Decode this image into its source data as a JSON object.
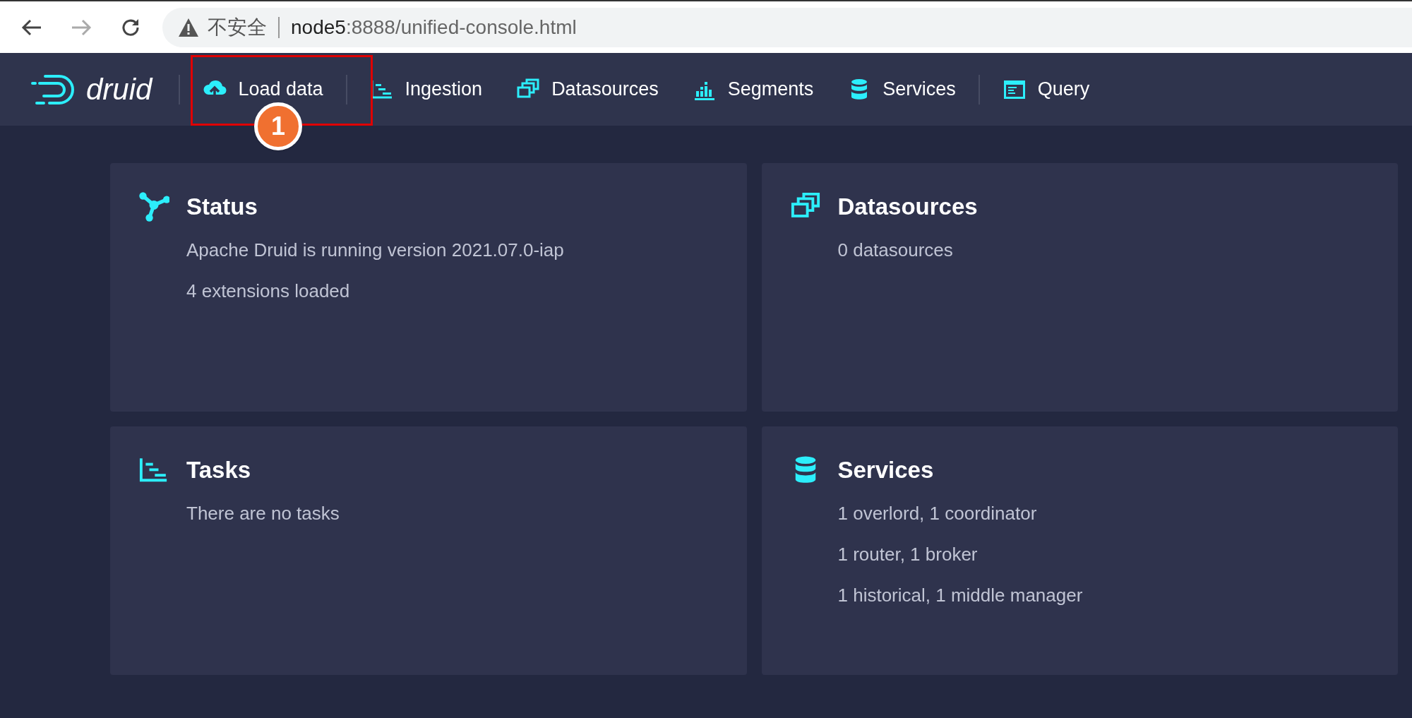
{
  "browser": {
    "security_label": "不安全",
    "url_host": "node5",
    "url_rest": ":8888/unified-console.html"
  },
  "logo": {
    "text": "druid"
  },
  "nav": [
    {
      "label": "Load data"
    },
    {
      "label": "Ingestion"
    },
    {
      "label": "Datasources"
    },
    {
      "label": "Segments"
    },
    {
      "label": "Services"
    },
    {
      "label": "Query"
    }
  ],
  "annotation": {
    "label": "1"
  },
  "cards": [
    {
      "title": "Status",
      "lines": [
        "Apache Druid is running version 2021.07.0-iap",
        "4 extensions loaded"
      ]
    },
    {
      "title": "Datasources",
      "lines": [
        "0 datasources"
      ]
    },
    {
      "title": "Tasks",
      "lines": [
        "There are no tasks"
      ]
    },
    {
      "title": "Services",
      "lines": [
        "1 overlord, 1 coordinator",
        "1 router, 1 broker",
        "1 historical, 1 middle manager"
      ]
    }
  ]
}
